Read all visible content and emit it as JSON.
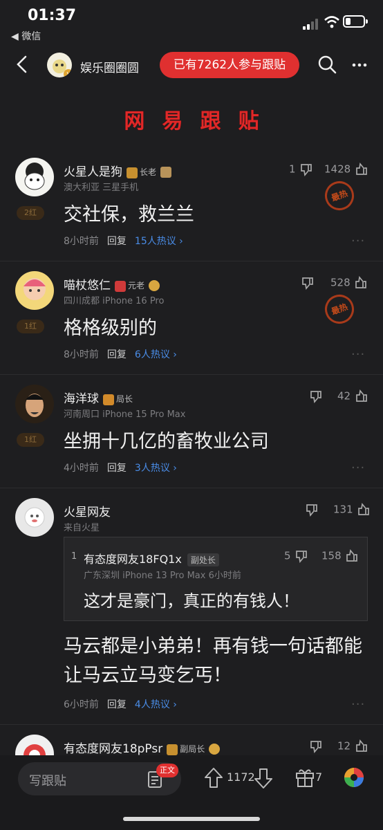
{
  "status": {
    "time": "01:37",
    "back_app": "◀ 微信"
  },
  "nav": {
    "name": "娱乐圈圈圆",
    "participants": "已有7262人参与跟贴",
    "verified": "v"
  },
  "banner": [
    "网",
    "易",
    "跟",
    "贴"
  ],
  "comments": [
    {
      "user": "火星人是狗",
      "rank": "长老",
      "meta": "澳大利亚  三星手机",
      "body": "交社保，救兰兰",
      "time": "8小时前",
      "reply": "回复",
      "hot": "15人热议 ›",
      "down": "1",
      "up": "1428",
      "tag": "2红",
      "stamp": "最热"
    },
    {
      "user": "喵杖悠仁",
      "rank": "元老",
      "meta": "四川成都  iPhone 16 Pro",
      "body": "格格级别的",
      "time": "8小时前",
      "reply": "回复",
      "hot": "6人热议 ›",
      "down": "",
      "up": "528",
      "tag": "1红",
      "stamp": "最热"
    },
    {
      "user": "海洋球",
      "rank": "局长",
      "meta": "河南周口  iPhone 15 Pro Max",
      "body": "坐拥十几亿的畜牧业公司",
      "time": "4小时前",
      "reply": "回复",
      "hot": "3人热议 ›",
      "down": "",
      "up": "42",
      "tag": "1红"
    },
    {
      "user": "火星网友",
      "meta": "来自火星",
      "body": "马云都是小弟弟！再有钱一句话都能让马云立马变乞丐！",
      "time": "6小时前",
      "reply": "回复",
      "hot": "4人热议 ›",
      "down": "",
      "up": "131",
      "quote": {
        "index": "1",
        "user": "有态度网友18FQ1x",
        "rank": "副处长",
        "meta": "广东深圳  iPhone 13 Pro Max  6小时前",
        "body": "这才是豪门，真正的有钱人！",
        "down": "5",
        "up": "158"
      }
    },
    {
      "user": "有态度网友18pPsr",
      "rank": "副局长",
      "up": "12"
    }
  ],
  "bottom": {
    "write": "写跟贴",
    "zhengwen": "正文",
    "votes": "1172",
    "gifts": "7"
  },
  "colors": {
    "accent": "#e03030",
    "link": "#4a8de8",
    "bg": "#1e1e20"
  }
}
